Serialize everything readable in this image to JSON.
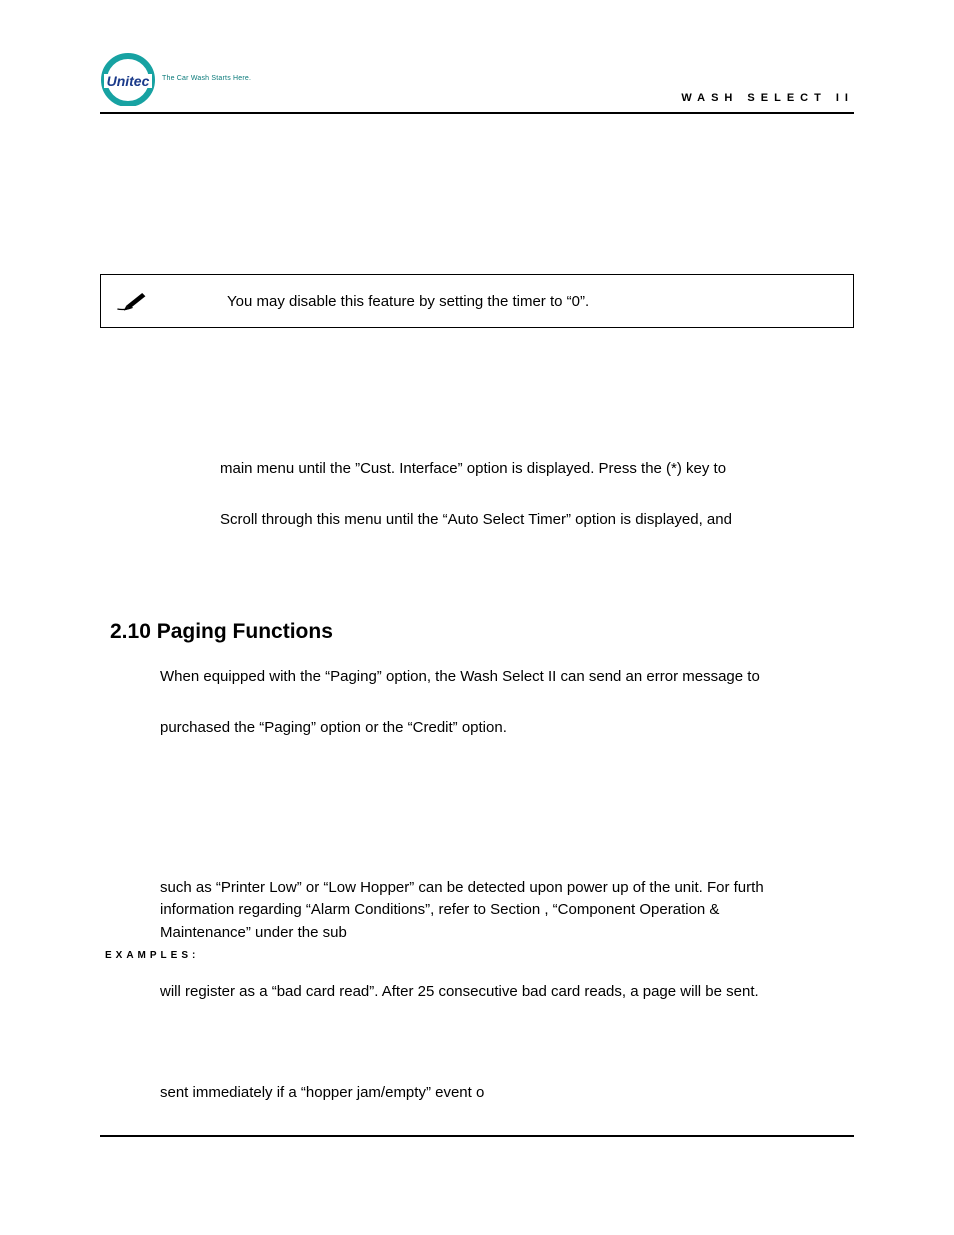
{
  "header": {
    "logo_text": "Unitec",
    "tagline": "The Car Wash Starts Here.",
    "right_title": "WASH SELECT II"
  },
  "note": {
    "icon": "pen-writing-icon",
    "text": "You may disable this feature by setting the timer to “0”."
  },
  "body": {
    "line1": "main menu until the ”Cust. Interface” option is displayed. Press the (*) key to",
    "line2": "Scroll through this menu until the “Auto Select Timer” option is displayed, and"
  },
  "section": {
    "heading": "2.10 Paging Functions",
    "p1": "When equipped with the “Paging” option, the Wash Select II can send an error message to",
    "p2": "purchased the “Paging” option or the “Credit” option.",
    "p3a": "such as “Printer Low” or “Low Hopper” can be detected upon power up of the unit. For furth",
    "p3b": "information regarding “Alarm Conditions”, refer to Section , “Component Operation &",
    "p3c": "Maintenance” under the sub",
    "examples_label": "EXAMPLES:",
    "p4": "will register as a “bad card read”. After 25 consecutive bad card reads, a page will be sent.",
    "p5": "sent immediately if a “hopper jam/empty” event o"
  }
}
